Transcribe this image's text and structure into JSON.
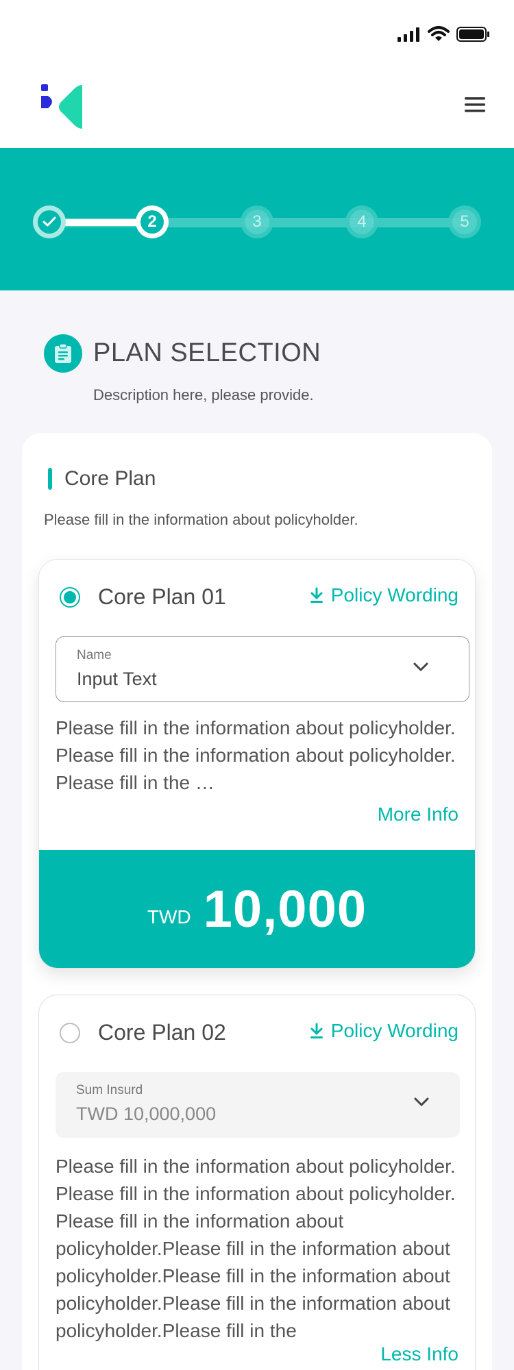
{
  "status_bar": {
    "icons": [
      "signal-icon",
      "wifi-icon",
      "battery-icon"
    ]
  },
  "header": {
    "logo": "brand-logo",
    "menu_icon": "hamburger-menu-icon"
  },
  "stepper": {
    "steps": [
      {
        "label": "",
        "state": "done"
      },
      {
        "label": "2",
        "state": "active"
      },
      {
        "label": "3",
        "state": "pending"
      },
      {
        "label": "4",
        "state": "pending"
      },
      {
        "label": "5",
        "state": "pending"
      }
    ],
    "colors": {
      "accent": "#00b8ad"
    }
  },
  "section": {
    "title": "PLAN SELECTION",
    "description": "Description here, please provide.",
    "icon": "clipboard-icon"
  },
  "core_plan": {
    "heading": "Core Plan",
    "subtitle": "Please fill in the information about policyholder.",
    "plans": [
      {
        "name": "Core Plan 01",
        "selected": true,
        "policy_link": "Policy Wording",
        "field_label": "Name",
        "field_value": "Input Text",
        "description": "Please fill in the information about policyholder. Please fill in the information about policyholder. Please fill in the …",
        "toggle_label": "More Info",
        "currency": "TWD",
        "amount": "10,000"
      },
      {
        "name": "Core Plan 02",
        "selected": false,
        "policy_link": "Policy Wording",
        "field_label": "Sum Insurd",
        "field_value": "TWD 10,000,000",
        "description": "Please fill in the information about policyholder. Please fill in the information about policyholder. Please fill in the information about policyholder.Please fill in the information about policyholder.Please fill in the information about policyholder.Please fill in the information about policyholder.Please fill in the",
        "toggle_label": "Less Info"
      }
    ]
  }
}
